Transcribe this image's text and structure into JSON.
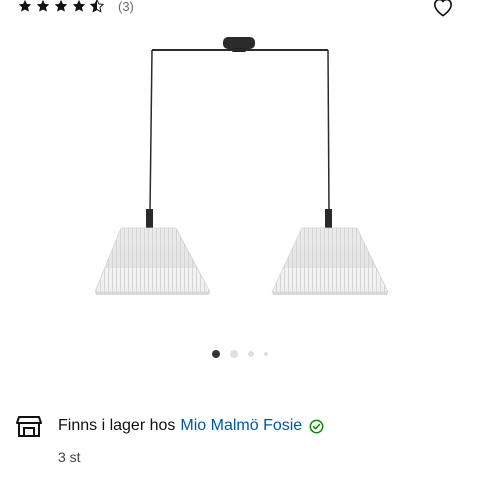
{
  "rating": {
    "stars": 4.5,
    "count_label": "(3)"
  },
  "product": {
    "image_icon": "pendant-lamp-two-pleated-shades",
    "gallery": {
      "total_images": 4,
      "active_index": 1
    }
  },
  "availability": {
    "icon": "store-icon",
    "prefix": "Finns i lager hos",
    "store_name": "Mio Malmö Fosie",
    "status_icon": "check-circle-icon",
    "quantity": "3 st"
  },
  "colors": {
    "text": "#111111",
    "muted": "#6b6b6b",
    "link": "#0058a3",
    "in_stock": "#0a8a00",
    "dot_active": "#333333",
    "dot_inactive": "#dfdfdf"
  }
}
